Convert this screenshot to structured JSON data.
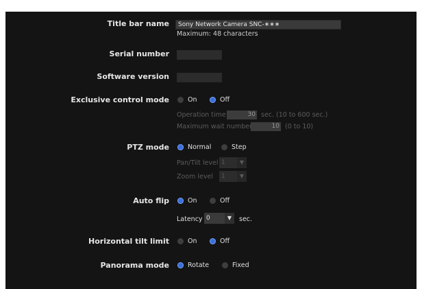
{
  "title_bar": {
    "label": "Title bar name",
    "value": "Sony Network Camera SNC-∗∗∗",
    "hint": "Maximum: 48 characters"
  },
  "serial_number": {
    "label": "Serial number",
    "value": ""
  },
  "software_version": {
    "label": "Software version",
    "value": ""
  },
  "exclusive_control": {
    "label": "Exclusive control mode",
    "on_label": "On",
    "off_label": "Off",
    "selected": "Off",
    "operation_time_label": "Operation time",
    "operation_time_value": "30",
    "operation_time_unit": "sec. (10 to 600 sec.)",
    "max_wait_label": "Maximum wait number",
    "max_wait_value": "10",
    "max_wait_range": "(0 to 10)"
  },
  "ptz_mode": {
    "label": "PTZ mode",
    "normal_label": "Normal",
    "step_label": "Step",
    "selected": "Normal",
    "pan_tilt_label": "Pan/Tilt level",
    "pan_tilt_value": "1",
    "zoom_label": "Zoom level",
    "zoom_value": "1"
  },
  "auto_flip": {
    "label": "Auto flip",
    "on_label": "On",
    "off_label": "Off",
    "selected": "On",
    "latency_label": "Latency",
    "latency_value": "0",
    "latency_unit": "sec."
  },
  "horizontal_tilt": {
    "label": "Horizontal tilt limit",
    "on_label": "On",
    "off_label": "Off",
    "selected": "Off"
  },
  "panorama": {
    "label": "Panorama mode",
    "rotate_label": "Rotate",
    "fixed_label": "Fixed",
    "selected": "Rotate"
  },
  "colors": {
    "background": "#141414",
    "accent": "#3b6fd6"
  }
}
